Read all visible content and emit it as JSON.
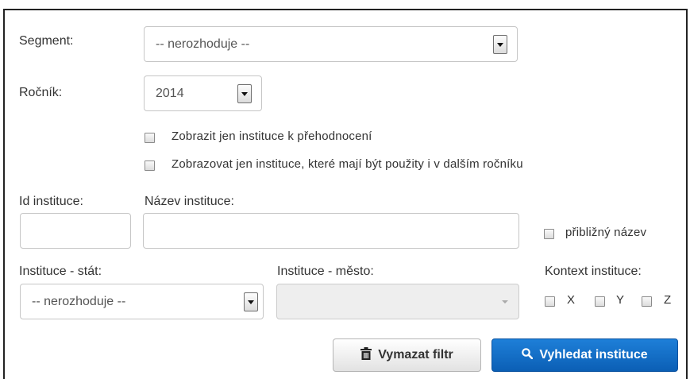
{
  "filters": {
    "segment": {
      "label": "Segment:",
      "value": "-- nerozhoduje --"
    },
    "rocnik": {
      "label": "Ročník:",
      "value": "2014"
    },
    "checkboxes": [
      {
        "label": "Zobrazit jen instituce k přehodnocení",
        "checked": false
      },
      {
        "label": "Zobrazovat jen instituce, které mají být použity i v dalším ročníku",
        "checked": false
      }
    ],
    "id_instituce": {
      "label": "Id instituce:",
      "value": ""
    },
    "nazev_instituce": {
      "label": "Název instituce:",
      "value": ""
    },
    "priblizny_nazev": {
      "label": "přibližný název",
      "checked": false
    },
    "stat": {
      "label": "Instituce - stát:",
      "value": "-- nerozhoduje --"
    },
    "mesto": {
      "label": "Instituce - město:",
      "value": ""
    },
    "kontext": {
      "label": "Kontext instituce:",
      "options": [
        {
          "label": "X",
          "checked": false
        },
        {
          "label": "Y",
          "checked": false
        },
        {
          "label": "Z",
          "checked": false
        }
      ]
    }
  },
  "buttons": {
    "clear": {
      "label": "Vymazat filtr",
      "icon": "trash-icon"
    },
    "search": {
      "label": "Vyhledat instituce",
      "icon": "search-icon",
      "color": "#0b63c3"
    }
  }
}
